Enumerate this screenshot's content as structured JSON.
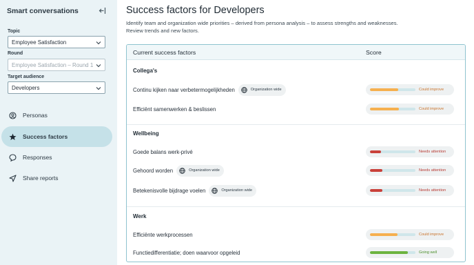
{
  "sidebar": {
    "title": "Smart conversations",
    "topic": {
      "label": "Topic",
      "value": "Employee Satisfaction"
    },
    "round": {
      "label": "Round",
      "value": "Employee Satisfaction – Round 1"
    },
    "audience": {
      "label": "Target audience",
      "value": "Developers"
    },
    "nav": [
      {
        "label": "Personas",
        "icon": "persona-icon"
      },
      {
        "label": "Success factors",
        "icon": "star-icon",
        "active": true
      },
      {
        "label": "Responses",
        "icon": "chat-bubble-icon"
      },
      {
        "label": "Share reports",
        "icon": "send-icon"
      }
    ]
  },
  "page": {
    "title": "Success factors for Developers",
    "description": "Identify team and organization wide priorities – derived from persona analysis – to assess strengths and weaknesses. Review trends and new factors."
  },
  "table": {
    "col_factor": "Current success factors",
    "col_score": "Score",
    "org_chip": "Organization wide",
    "sections": [
      {
        "title": "Collega's",
        "rows": [
          {
            "label": "Continu kijken naar verbetermogelijkheden",
            "org_wide": true,
            "score_label": "Could improve",
            "level": 0.62,
            "status": "improve"
          },
          {
            "label": "Efficiënt samenwerken & beslissen",
            "org_wide": false,
            "score_label": "Could improve",
            "level": 0.64,
            "status": "improve"
          }
        ]
      },
      {
        "title": "Wellbeing",
        "rows": [
          {
            "label": "Goede balans werk-privé",
            "org_wide": false,
            "score_label": "Needs attention",
            "level": 0.24,
            "status": "attention"
          },
          {
            "label": "Gehoord worden",
            "org_wide": true,
            "score_label": "Needs attention",
            "level": 0.28,
            "status": "attention"
          },
          {
            "label": "Betekenisvolle bijdrage voelen",
            "org_wide": true,
            "score_label": "Needs attention",
            "level": 0.28,
            "status": "attention"
          }
        ]
      },
      {
        "title": "Werk",
        "rows": [
          {
            "label": "Efficiënte werkprocessen",
            "org_wide": false,
            "score_label": "Could improve",
            "level": 0.6,
            "status": "improve"
          },
          {
            "label": "Functiedifferentiatie; doen waarvoor opgeleid",
            "org_wide": false,
            "score_label": "Going well",
            "level": 0.84,
            "status": "well"
          }
        ]
      }
    ]
  },
  "colors": {
    "improve": "#f6b04f",
    "improve_text": "#c8722a",
    "attention": "#c9413a",
    "attention_text": "#b73a33",
    "well": "#6cb33f",
    "well_text": "#4b8f2a",
    "accent": "#8ec3cf"
  }
}
